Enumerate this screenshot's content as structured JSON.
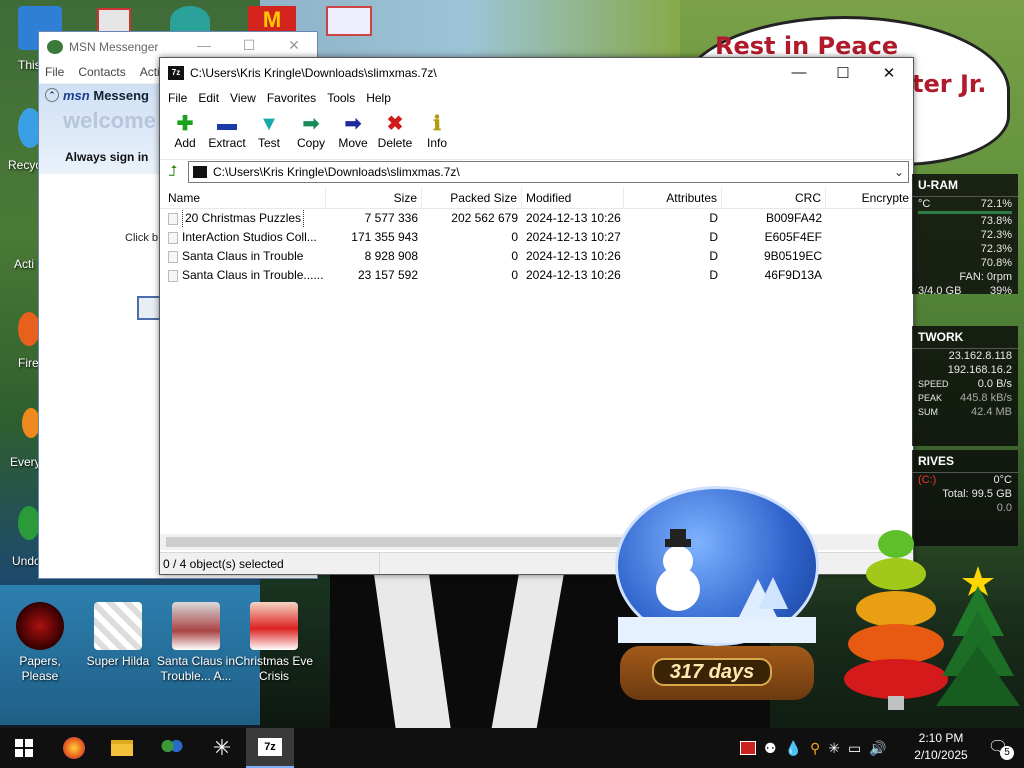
{
  "desktop": {
    "rip_sign": {
      "line1": "Rest in Peace",
      "line2": "ter Jr."
    },
    "edge_labels": [
      "This",
      "Recyc",
      "Acti",
      "Fire",
      "Every",
      "Undo"
    ],
    "icons": [
      {
        "label": "Papers, Please",
        "icon": "papers-please-icon"
      },
      {
        "label": "Super Hilda",
        "icon": "super-hilda-icon"
      },
      {
        "label": "Santa Claus in Trouble... A...",
        "icon": "santa-claus-icon"
      },
      {
        "label": "Christmas Eve Crisis",
        "icon": "christmas-eve-crisis-icon"
      }
    ],
    "snowglobe_days": "317 days"
  },
  "msn": {
    "title": "MSN Messenger",
    "menu": [
      "File",
      "Contacts",
      "Acti"
    ],
    "logo": "msn",
    "logo_suffix": "Messeng",
    "welcome": "welcome",
    "always_sign_in": "Always sign in",
    "click_text": "Click b"
  },
  "zip": {
    "title": "C:\\Users\\Kris Kringle\\Downloads\\slimxmas.7z\\",
    "app_badge": "7z",
    "menu": [
      "File",
      "Edit",
      "View",
      "Favorites",
      "Tools",
      "Help"
    ],
    "toolbar": [
      {
        "label": "Add",
        "icon": "plus-icon",
        "glyph": "✚",
        "color": "#1aa31a"
      },
      {
        "label": "Extract",
        "icon": "minus-icon",
        "glyph": "▬",
        "color": "#1c3aa8"
      },
      {
        "label": "Test",
        "icon": "check-icon",
        "glyph": "▼",
        "color": "#1aa8a8"
      },
      {
        "label": "Copy",
        "icon": "copy-arrow-icon",
        "glyph": "➡",
        "color": "#1a8a5a"
      },
      {
        "label": "Move",
        "icon": "move-arrow-icon",
        "glyph": "➡",
        "color": "#1c2a9c"
      },
      {
        "label": "Delete",
        "icon": "delete-icon",
        "glyph": "✖",
        "color": "#d11a1a"
      },
      {
        "label": "Info",
        "icon": "info-icon",
        "glyph": "ℹ",
        "color": "#b19a10"
      }
    ],
    "address": "C:\\Users\\Kris Kringle\\Downloads\\slimxmas.7z\\",
    "columns": [
      "Name",
      "Size",
      "Packed Size",
      "Modified",
      "Attributes",
      "CRC",
      "Encrypte"
    ],
    "rows": [
      {
        "name": "20 Christmas Puzzles",
        "size": "7 577 336",
        "packed": "202 562 679",
        "modified": "2024-12-13 10:26",
        "attr": "D",
        "crc": "B009FA42",
        "enc": ""
      },
      {
        "name": "InterAction Studios Coll...",
        "size": "171 355 943",
        "packed": "0",
        "modified": "2024-12-13 10:27",
        "attr": "D",
        "crc": "E605F4EF",
        "enc": ""
      },
      {
        "name": "Santa Claus in Trouble",
        "size": "8 928 908",
        "packed": "0",
        "modified": "2024-12-13 10:26",
        "attr": "D",
        "crc": "9B0519EC",
        "enc": ""
      },
      {
        "name": "Santa Claus in Trouble......",
        "size": "23 157 592",
        "packed": "0",
        "modified": "2024-12-13 10:26",
        "attr": "D",
        "crc": "46F9D13A",
        "enc": ""
      }
    ],
    "status": "0 / 4 object(s) selected"
  },
  "widgets": {
    "ram": {
      "title": "U-RAM",
      "lines": [
        {
          "left": "°C",
          "right": "72.1%"
        },
        {
          "left": "",
          "right": "73.8%"
        },
        {
          "left": "",
          "right": "72.3%"
        },
        {
          "left": "",
          "right": "72.3%"
        },
        {
          "left": "",
          "right": "70.8%"
        },
        {
          "left": "",
          "right": "FAN: 0rpm"
        },
        {
          "left": "3/4.0 GB",
          "right": "39%"
        }
      ]
    },
    "network": {
      "title": "TWORK",
      "lines": [
        {
          "left": "",
          "right": "23.162.8.118"
        },
        {
          "left": "",
          "right": "192.168.16.2"
        },
        {
          "left": "SPEED",
          "right": "0.0 B/s"
        },
        {
          "left": "PEAK",
          "right": "445.8 kB/s"
        },
        {
          "left": "SUM",
          "right": "42.4 MB"
        }
      ]
    },
    "drives": {
      "title": "RIVES",
      "lines": [
        {
          "left": "(C:)",
          "right": "0°C"
        },
        {
          "left": "",
          "right": "Total: 99.5 GB"
        },
        {
          "left": "",
          "right": "0.0"
        }
      ]
    }
  },
  "taskbar": {
    "apps": [
      {
        "name": "start-button",
        "icon": "windows-icon"
      },
      {
        "name": "firefox",
        "icon": "firefox-icon"
      },
      {
        "name": "file-explorer",
        "icon": "folder-icon"
      },
      {
        "name": "msn",
        "icon": "msn-people-icon"
      },
      {
        "name": "snowflake-app",
        "icon": "snowflake-icon"
      },
      {
        "name": "7zip",
        "icon": "7zip-icon",
        "glyph": "7z"
      }
    ],
    "time": "2:10 PM",
    "date": "2/10/2025",
    "notification_count": "5"
  }
}
